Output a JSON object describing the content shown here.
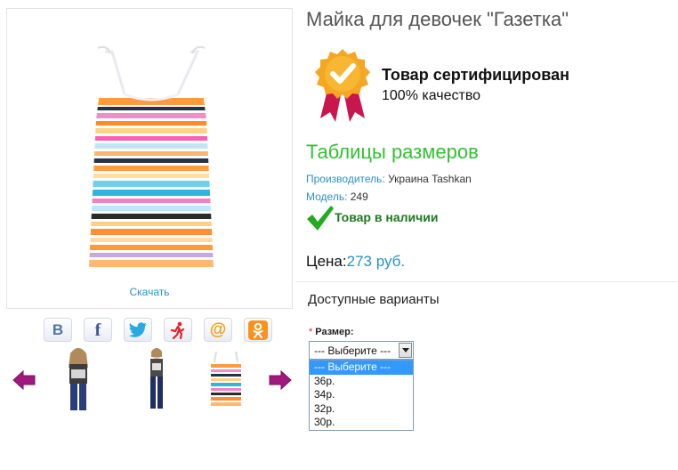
{
  "product": {
    "title": "Майка для девочек \"Газетка\"",
    "download_label": "Скачать"
  },
  "certificate": {
    "title": "Товар сертифицирован",
    "subtitle": "100% качество"
  },
  "size_table_link": "Таблицы размеров",
  "meta": {
    "manufacturer_label": "Производитель:",
    "manufacturer_value": " Украина Tashkan",
    "model_label": "Модель:",
    "model_value": " 249"
  },
  "stock_status": "Товар в наличии",
  "price": {
    "label": "Цена:",
    "value": "273 руб."
  },
  "options": {
    "section_title": "Доступные варианты",
    "required_mark": "*",
    "size_label": "Размер:",
    "selected_value": "--- Выберите ---",
    "dropdown_options": [
      "--- Выберите ---",
      "36р.",
      "34р.",
      "32р.",
      "30р."
    ]
  },
  "share_buttons": [
    {
      "icon": "vk-icon",
      "glyph": "B",
      "color": "#4a76a8"
    },
    {
      "icon": "facebook-icon",
      "glyph": "f",
      "color": "#3b5998"
    },
    {
      "icon": "twitter-icon",
      "glyph": "🐦",
      "color": "#29a9e0"
    },
    {
      "icon": "odnoklassniki-run-icon",
      "glyph": "ℛ",
      "color": "#e0252b"
    },
    {
      "icon": "mail-at-icon",
      "glyph": "@",
      "color": "#f39c12"
    },
    {
      "icon": "odnoklassniki-icon",
      "glyph": "ок",
      "color": "#f7931e"
    }
  ],
  "colors": {
    "link_blue": "#2a91c9",
    "green_link": "#33c033",
    "stock_green": "#1f7a1f",
    "arrow_purple": "#a0197e",
    "dropdown_highlight": "#3399ff"
  }
}
